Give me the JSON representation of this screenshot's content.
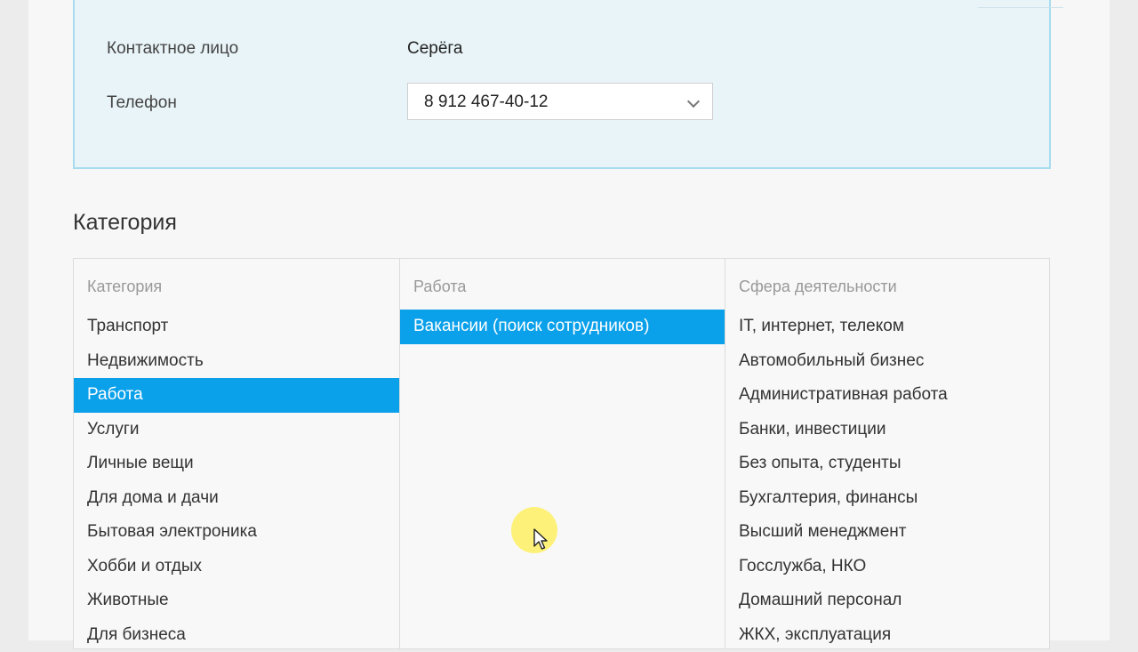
{
  "contact": {
    "person_label": "Контактное лицо",
    "person_value": "Серёга",
    "phone_label": "Телефон",
    "phone_value": "8 912 467-40-12"
  },
  "category_section": {
    "title": "Категория",
    "columns": [
      {
        "header": "Категория",
        "items": [
          "Транспорт",
          "Недвижимость",
          "Работа",
          "Услуги",
          "Личные вещи",
          "Для дома и дачи",
          "Бытовая электроника",
          "Хобби и отдых",
          "Животные",
          "Для бизнеса"
        ],
        "selected_index": 2
      },
      {
        "header": "Работа",
        "items": [
          "Вакансии (поиск сотрудников)"
        ],
        "selected_index": 0
      },
      {
        "header": "Сфера деятельности",
        "items": [
          "IT, интернет, телеком",
          "Автомобильный бизнес",
          "Административная работа",
          "Банки, инвестиции",
          "Без опыта, студенты",
          "Бухгалтерия, финансы",
          "Высший менеджмент",
          "Госслужба, НКО",
          "Домашний персонал",
          "ЖКХ, эксплуатация"
        ],
        "selected_index": null
      }
    ]
  },
  "colors": {
    "selected_bg": "#0aa0ea",
    "contact_box_bg": "#e9f4f8",
    "contact_box_border": "#a7dcef",
    "cursor_highlight": "#fff064"
  },
  "icons": {
    "select_arrow": "chevron-down-icon",
    "cursor": "mouse-pointer-icon"
  }
}
